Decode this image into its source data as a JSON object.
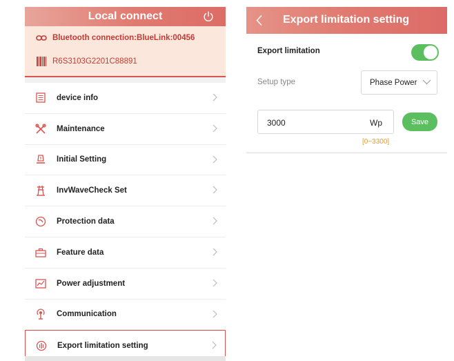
{
  "left": {
    "title": "Local connect",
    "bluetooth": "Bluetooth connection:BlueLink:00456",
    "serial": "R6S3103G2201C88891",
    "menu": [
      {
        "label": "device info",
        "icon": "document-list-icon"
      },
      {
        "label": "Maintenance",
        "icon": "tools-icon"
      },
      {
        "label": "Initial Setting",
        "icon": "initial-setting-icon"
      },
      {
        "label": "InvWaveCheck Set",
        "icon": "tower-icon"
      },
      {
        "label": "Protection data",
        "icon": "protection-icon"
      },
      {
        "label": "Feature data",
        "icon": "briefcase-icon"
      },
      {
        "label": "Power adjustment",
        "icon": "chart-icon"
      },
      {
        "label": "Communication",
        "icon": "antenna-icon"
      },
      {
        "label": "Export limitation setting",
        "icon": "export-limit-icon"
      }
    ],
    "selected_index": 8
  },
  "right": {
    "title": "Export limitation setting",
    "export_limitation_label": "Export limitation",
    "export_limitation_enabled": true,
    "setup_type_label": "Setup type",
    "setup_type_value": "Phase Power",
    "value": "3000",
    "unit": "Wp",
    "save_label": "Save",
    "range": "[0~3300]"
  },
  "colors": {
    "accent_red": "#d9534f",
    "header_gradient": "#e07a70",
    "info_bg": "#fbe7dc",
    "green": "#5bbf60",
    "range_orange": "#e89a3c"
  }
}
